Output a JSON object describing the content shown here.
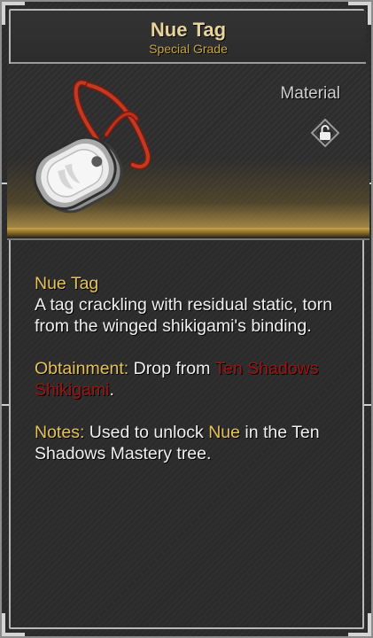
{
  "header": {
    "title": "Nue Tag",
    "grade": "Special Grade"
  },
  "item": {
    "type": "Material",
    "lock_icon": "padlock-icon",
    "image": "dog-tag-on-red-cord"
  },
  "description": {
    "name": "Nue Tag",
    "flavor": "A tag crackling with residual static, torn from the winged shikigami's binding.",
    "obtainment_label": "Obtainment:",
    "obtainment_text": "Drop from",
    "obtainment_source": "Ten Shadows Shikigami",
    "obtainment_end": ".",
    "notes_label": "Notes:",
    "notes_pre": "Used to unlock",
    "notes_highlight": "Nue",
    "notes_post": "in the Ten Shadows Mastery tree."
  },
  "colors": {
    "title": "#e8d49a",
    "grade": "#c8a447",
    "label_gold": "#e6c25a",
    "source_red": "#9b1414",
    "body_text": "#f0f0f0"
  }
}
